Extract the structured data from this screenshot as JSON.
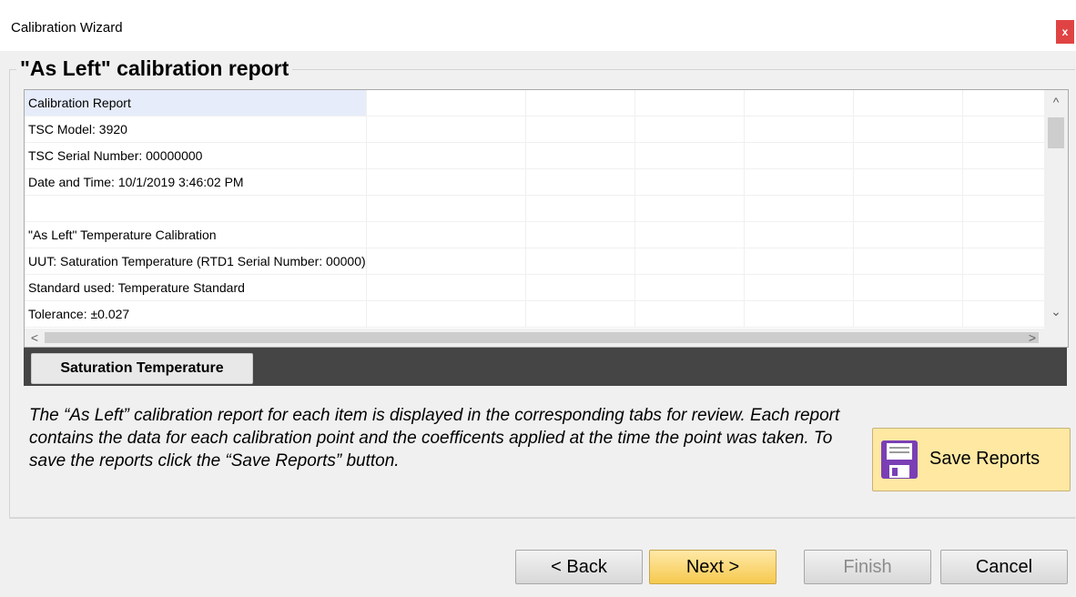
{
  "window": {
    "title": "Calibration Wizard",
    "close_label": "x"
  },
  "report": {
    "group_title": "\"As Left\" calibration report",
    "rows": [
      "Calibration Report",
      "TSC Model: 3920",
      "TSC Serial Number: 00000000",
      "Date and Time: 10/1/2019 3:46:02 PM",
      "",
      "\"As Left\" Temperature Calibration",
      "UUT: Saturation Temperature (RTD1 Serial Number: 00000)",
      "Standard used: Temperature Standard",
      "Tolerance: ±0.027"
    ],
    "scroll": {
      "up": "^",
      "down": "⌄",
      "left": "<",
      "right": ">"
    }
  },
  "tabs": [
    {
      "label": "Saturation Temperature"
    }
  ],
  "description": "The “As Left” calibration report for each item is displayed in the corresponding tabs for review.  Each report contains the data for each calibration point and the coefficents applied at the time the point was taken.  To save the reports click the “Save Reports” button.",
  "save_button": {
    "label": "Save Reports",
    "icon": "floppy-disk-icon",
    "color": "#fee8a2"
  },
  "nav": {
    "back": "< Back",
    "next": "Next >",
    "finish": "Finish",
    "cancel": "Cancel"
  },
  "colors": {
    "accent": "#f6c94e",
    "tabstrip": "#454545",
    "close": "#e04343"
  }
}
